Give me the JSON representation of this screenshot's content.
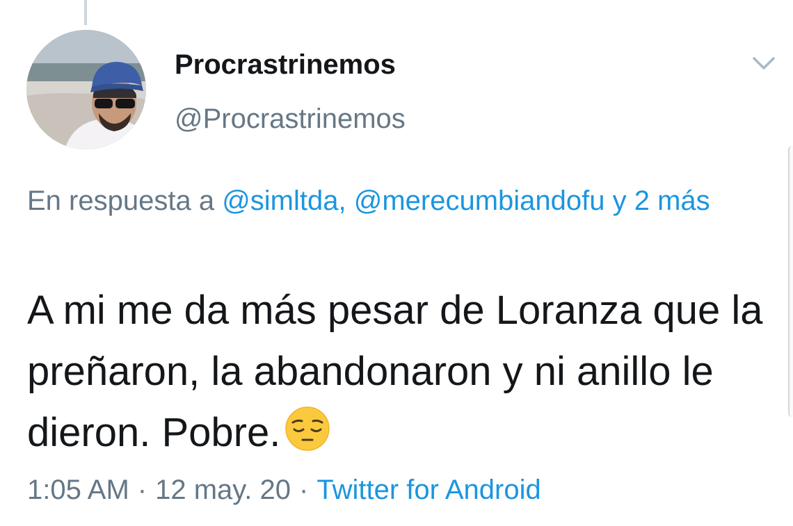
{
  "author": {
    "display_name": "Procrastrinemos",
    "handle": "@Procrastrinemos",
    "avatar_icon": "profile-photo"
  },
  "reply_context": {
    "prefix": "En respuesta a",
    "mentions": [
      "@simltda,",
      "@merecumbiandofu"
    ],
    "suffix": "y 2 más"
  },
  "tweet": {
    "text": "A mi me da más pesar de Loranza que la preñaron, la abandonaron y ni anillo le dieron. Pobre.",
    "emoji_icon": "pensive-face-emoji"
  },
  "meta": {
    "time": "1:05 AM",
    "separator": "·",
    "date": "12 may. 20",
    "source": "Twitter for Android"
  },
  "menu_icon": "chevron-down-icon",
  "colors": {
    "text": "#14171a",
    "secondary": "#657786",
    "link": "#1b95e0",
    "thread_line": "#ccd6dd"
  }
}
